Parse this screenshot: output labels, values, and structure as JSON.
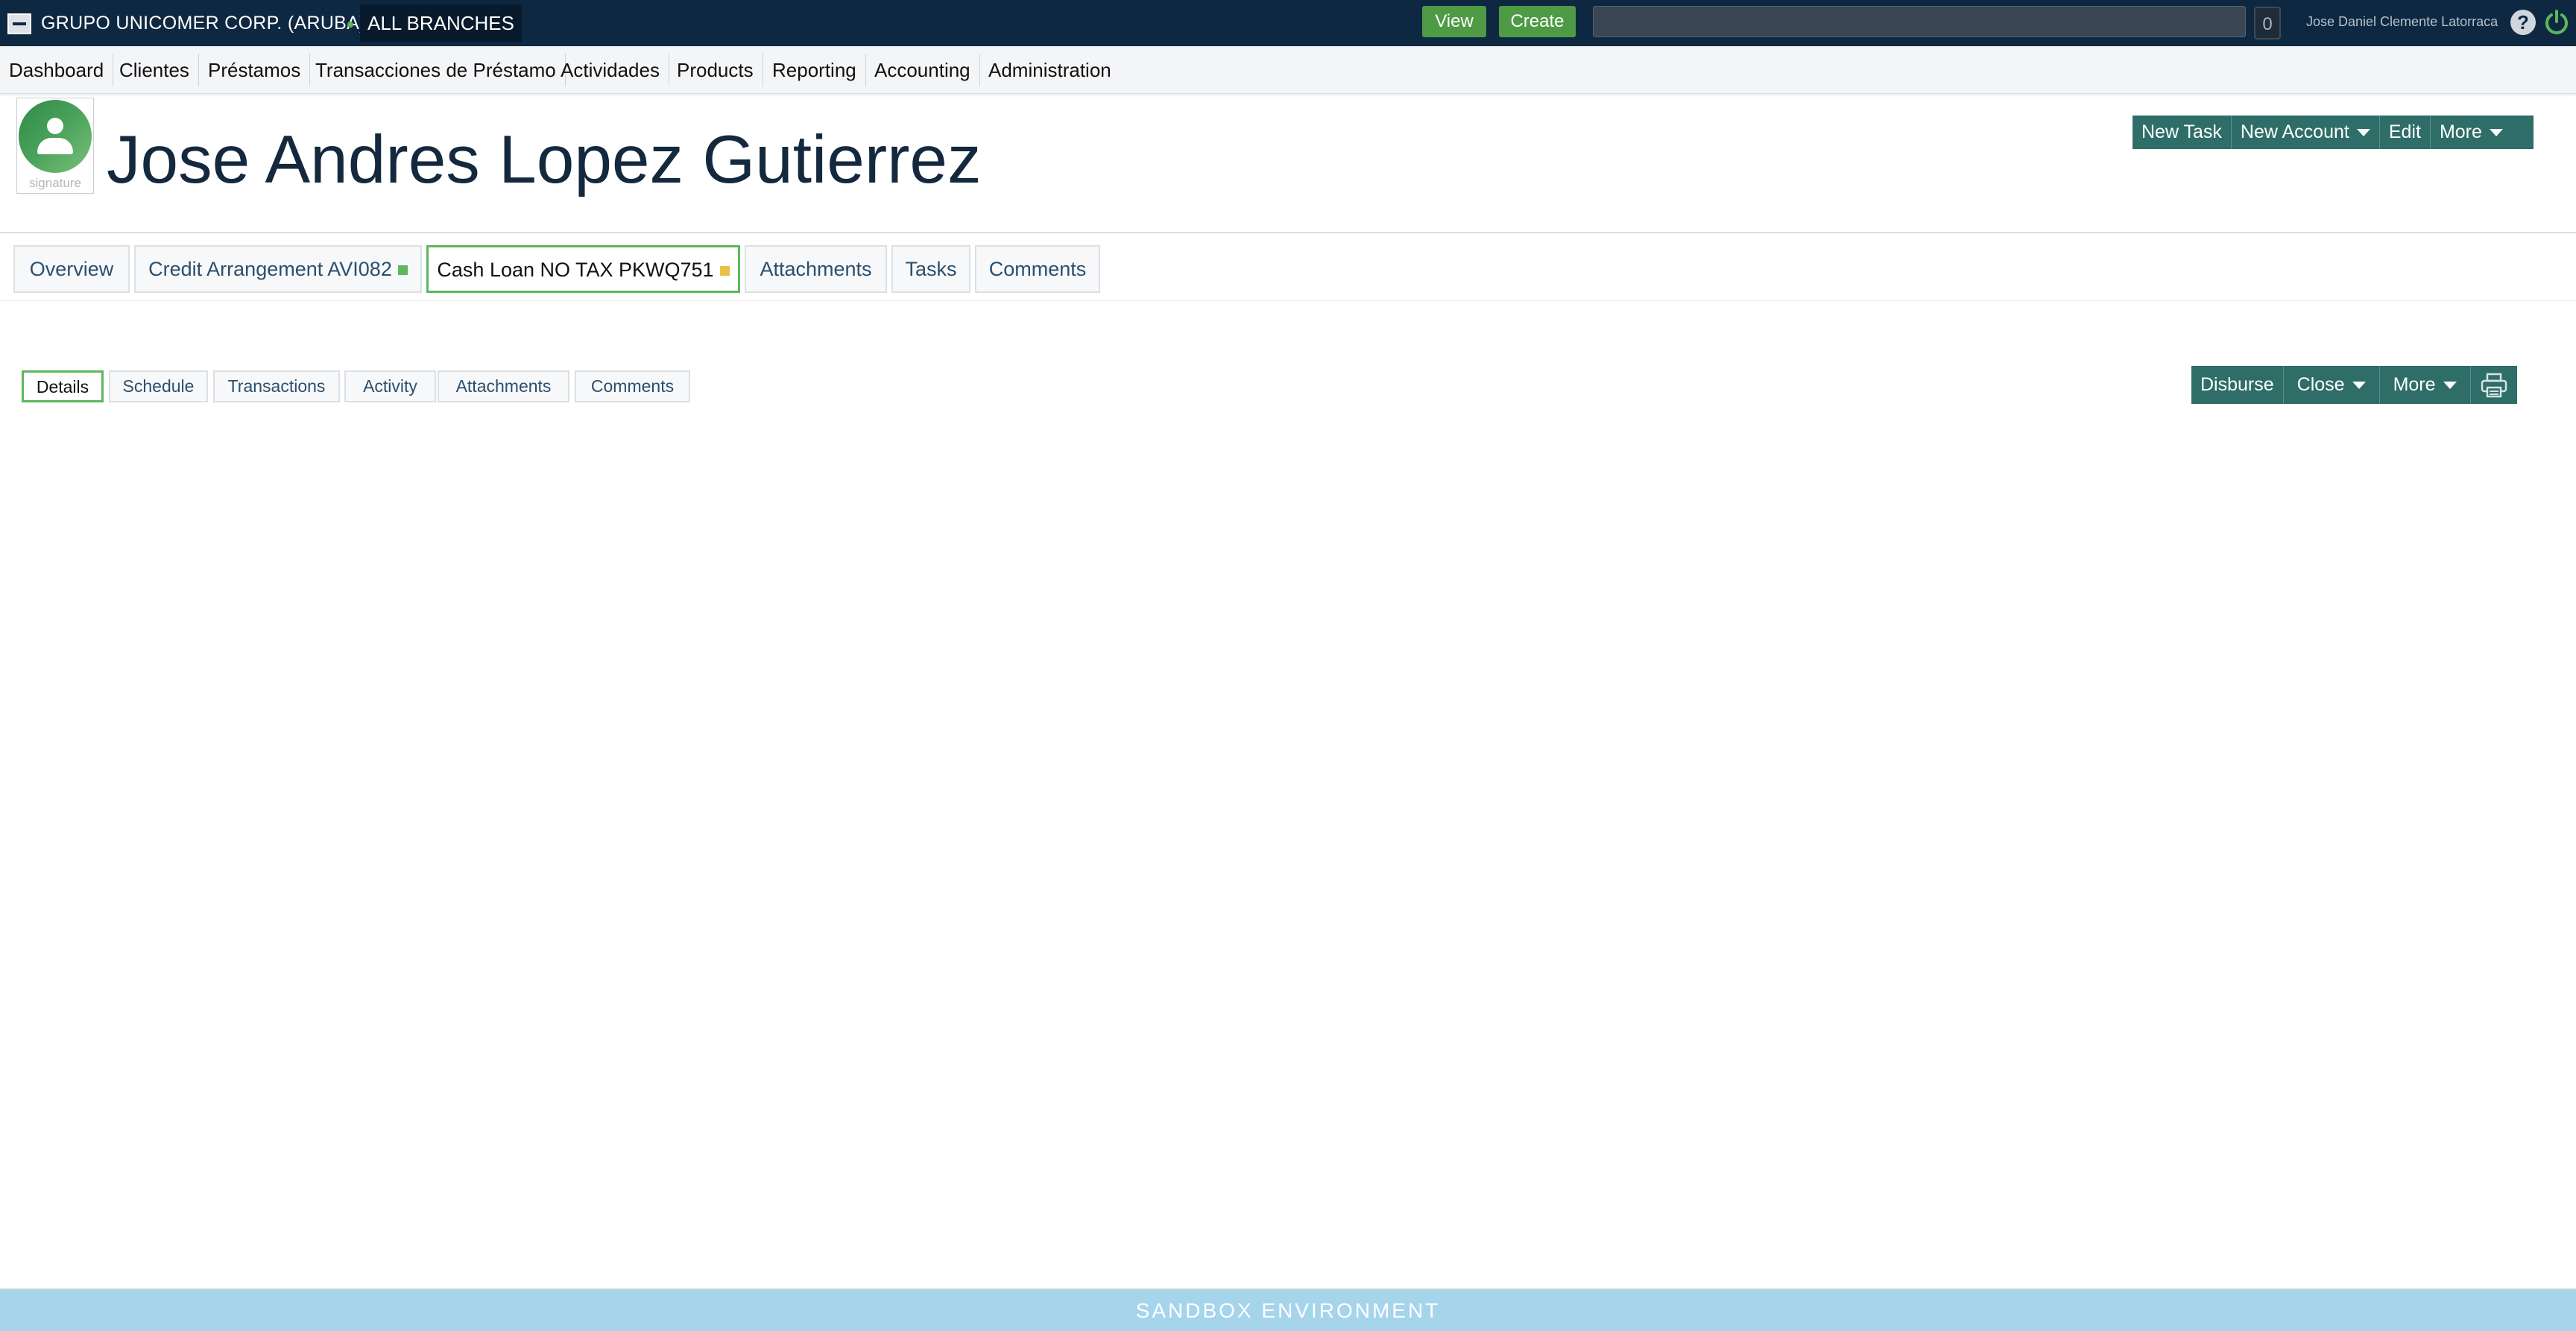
{
  "topbar": {
    "org_name": "GRUPO UNICOMER CORP. (ARUBA)",
    "branch": "ALL BRANCHES",
    "view_label": "View",
    "create_label": "Create",
    "search_value": "",
    "notification_count": "0",
    "user_name": "Jose Daniel Clemente Latorraca",
    "help_glyph": "?",
    "icons": {
      "logo": "org-logo-icon",
      "help": "help-icon",
      "logout": "power-icon"
    },
    "colors": {
      "bar": "#0f2841",
      "button": "#4e9a45"
    }
  },
  "mainnav": {
    "items": [
      {
        "label": "Dashboard"
      },
      {
        "label": "Clientes"
      },
      {
        "label": "Préstamos"
      },
      {
        "label": "Transacciones  de  Préstamo"
      },
      {
        "label": "Actividades"
      },
      {
        "label": "Products"
      },
      {
        "label": "Reporting"
      },
      {
        "label": "Accounting"
      },
      {
        "label": "Administration"
      }
    ]
  },
  "header": {
    "avatar_caption": "signature",
    "title": "Jose Andres Lopez Gutierrez",
    "actions": {
      "new_task": "New  Task",
      "new_account": "New  Account",
      "edit": "Edit",
      "more": "More"
    },
    "colors": {
      "action_bar": "#2e6d68"
    }
  },
  "primary_tabs": {
    "items": [
      {
        "label": "Overview"
      },
      {
        "label": "Credit Arrangement AVI082",
        "status_color": "#5cb85c"
      },
      {
        "label": "Cash Loan NO TAX PKWQ751",
        "status_color": "#e8c14a",
        "active": true
      },
      {
        "label": "Attachments"
      },
      {
        "label": "Tasks"
      },
      {
        "label": "Comments"
      }
    ]
  },
  "secondary_tabs": {
    "items": [
      {
        "label": "Details",
        "active": true
      },
      {
        "label": "Schedule"
      },
      {
        "label": "Transactions"
      },
      {
        "label": "Activity"
      },
      {
        "label": "Attachments"
      },
      {
        "label": "Comments"
      }
    ],
    "actions": {
      "disburse": "Disburse",
      "close": "Close",
      "more": "More",
      "print_icon": "printer-icon"
    }
  },
  "footer": {
    "banner": "SANDBOX ENVIRONMENT",
    "color": "#a5d4eb"
  }
}
